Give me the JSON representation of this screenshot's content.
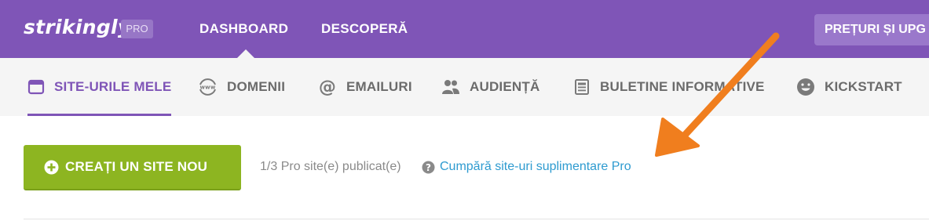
{
  "header": {
    "logo": "strikingly",
    "badge": "PRO",
    "nav": [
      {
        "label": "DASHBOARD"
      },
      {
        "label": "DESCOPERĂ"
      }
    ],
    "pricing_button": "PREȚURI ȘI UPG"
  },
  "tabs": [
    {
      "label": "SITE-URILE MELE",
      "icon": "browser-window-icon",
      "active": true
    },
    {
      "label": "DOMENII",
      "icon": "www-globe-icon",
      "active": false
    },
    {
      "label": "EMAILURI",
      "icon": "at-sign-icon",
      "active": false
    },
    {
      "label": "AUDIENȚĂ",
      "icon": "users-icon",
      "active": false
    },
    {
      "label": "BULETINE INFORMATIVE",
      "icon": "newsletter-icon",
      "active": false
    },
    {
      "label": "KICKSTART",
      "icon": "smiley-icon",
      "active": false
    }
  ],
  "content": {
    "create_button": "CREAȚI UN SITE NOU",
    "published_status": "1/3 Pro site(e) publicat(e)",
    "buy_link": "Cumpără site-uri suplimentare Pro"
  },
  "colors": {
    "brand_purple": "#7f55b7",
    "green_button": "#8db521",
    "link_blue": "#2e9bd0",
    "arrow_orange": "#f07e1e"
  }
}
